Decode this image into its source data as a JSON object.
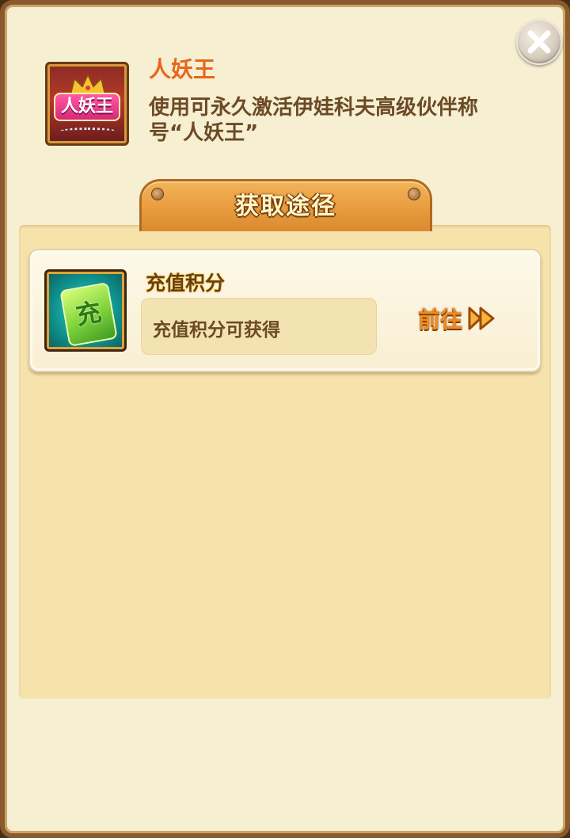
{
  "item": {
    "name": "人妖王",
    "description": "使用可永久激活伊娃科夫高级伙伴称号“人妖王”",
    "icon_text": "人妖王",
    "icon": "title-badge-icon"
  },
  "section": {
    "title": "获取途径"
  },
  "sources": [
    {
      "title": "充值积分",
      "description": "充值积分可获得",
      "icon": "recharge-card-icon",
      "icon_text": "充",
      "action_label": "前往"
    }
  ],
  "colors": {
    "accent": "#e8661c",
    "panel": "#f6e3ab",
    "background": "#f6efd2",
    "tab": "#e79a3c"
  }
}
